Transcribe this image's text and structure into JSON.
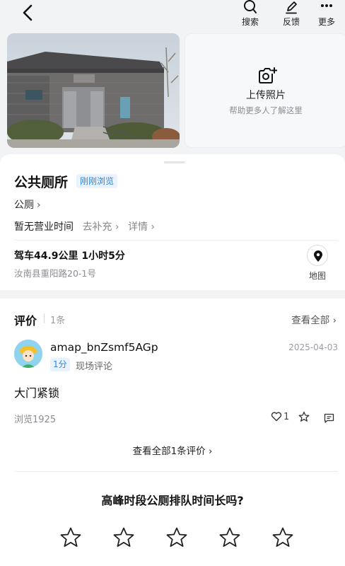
{
  "topbar": {
    "back_icon": "chevron-left-icon",
    "actions": [
      {
        "label": "搜索",
        "icon": "search-icon"
      },
      {
        "label": "反馈",
        "icon": "edit-icon"
      },
      {
        "label": "更多",
        "icon": "more-icon"
      }
    ]
  },
  "upload": {
    "title": "上传照片",
    "subtitle": "帮助更多人了解这里",
    "icon": "camera-plus-icon"
  },
  "poi": {
    "name": "公共厕所",
    "recent_tag": "刚刚浏览",
    "category": "公厕",
    "hours": "暂无营业时间",
    "supplement_link": "去补充",
    "detail_link": "详情",
    "route": "驾车44.9公里 1小时5分",
    "address": "汝南县重阳路20-1号",
    "map_label": "地图"
  },
  "reviews": {
    "title": "评价",
    "count": "1条",
    "view_all": "查看全部",
    "items": [
      {
        "user": "amap_bnZsmf5AGp",
        "date": "2025-04-03",
        "score": "1分",
        "type": "现场评论",
        "body": "大门紧锁",
        "views": "浏览1925",
        "likes": "1"
      }
    ],
    "view_all_bottom": "查看全部1条评价"
  },
  "survey": {
    "question": "高峰时段公厕排队时间长吗?",
    "star_count": 5
  },
  "colors": {
    "accent": "#2a86e0",
    "tag_bg": "#eaf3fd",
    "background": "#f2f3f5"
  }
}
